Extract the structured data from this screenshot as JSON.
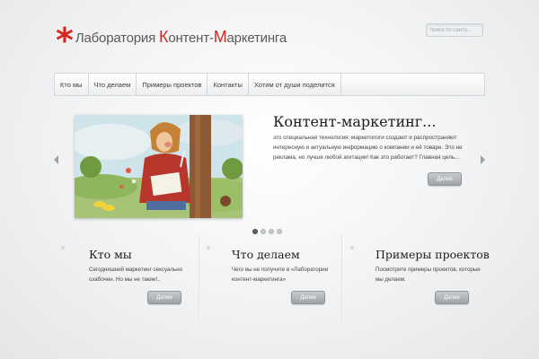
{
  "header": {
    "logo_star": "*",
    "logo_parts": [
      "Лаборатория ",
      "К",
      "онтент-",
      "М",
      "аркетинга"
    ],
    "search_placeholder": "поиск по сайту..."
  },
  "nav": {
    "items": [
      {
        "label": "Кто мы"
      },
      {
        "label": "Что делаем"
      },
      {
        "label": "Примеры проектов"
      },
      {
        "label": "Контакты"
      },
      {
        "label": "Хотим от души поделится"
      }
    ]
  },
  "slider": {
    "title": "Контент-маркетинг...",
    "text": "это специальная технология: маркетологи создают и распространяют интересную и актуальную информацию о компании и её товаре. Это не реклама, но лучше любой агитации! Как это работает? Главная цель...",
    "button_label": "Далее",
    "image_icon": "illustrated-writer-under-tree",
    "dots_count": 4,
    "active_dot": 1
  },
  "columns": [
    {
      "title": "Кто мы",
      "text": "Сегодняшний маркетинг сексуально озабочен. Но мы не такие!..",
      "button_label": "Далее"
    },
    {
      "title": "Что делаем",
      "text": "Чего вы не получите в «Лаборатории контент-маркетинга»",
      "button_label": "Далее"
    },
    {
      "title": "Примеры проектов",
      "text": "Посмотрите примеры проектов, которые мы делаем.",
      "button_label": "Далее"
    }
  ],
  "colors": {
    "accent_red": "#d42a1f",
    "button_gray": "#9ea3a7",
    "background": "#eceef0"
  }
}
